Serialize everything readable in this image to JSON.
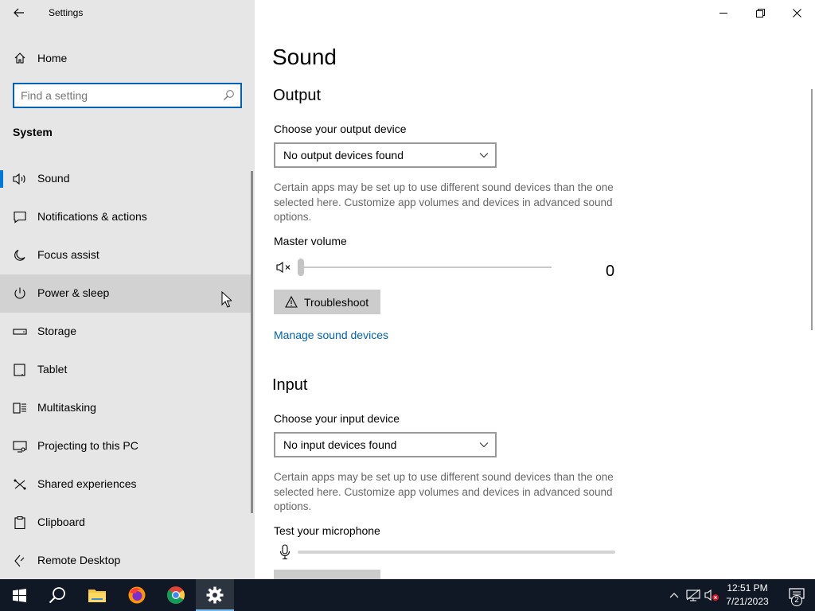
{
  "window": {
    "title": "Settings",
    "controls": [
      "minimize",
      "restore",
      "close"
    ]
  },
  "sidebar": {
    "home_label": "Home",
    "search_placeholder": "Find a setting",
    "section": "System",
    "items": [
      {
        "label": "Sound",
        "icon": "speaker-icon",
        "selected": true
      },
      {
        "label": "Notifications & actions",
        "icon": "message-icon"
      },
      {
        "label": "Focus assist",
        "icon": "moon-icon"
      },
      {
        "label": "Power & sleep",
        "icon": "power-icon",
        "hover": true
      },
      {
        "label": "Storage",
        "icon": "drive-icon"
      },
      {
        "label": "Tablet",
        "icon": "tablet-icon"
      },
      {
        "label": "Multitasking",
        "icon": "multitask-icon"
      },
      {
        "label": "Projecting to this PC",
        "icon": "projector-icon"
      },
      {
        "label": "Shared experiences",
        "icon": "shared-icon"
      },
      {
        "label": "Clipboard",
        "icon": "clipboard-icon"
      },
      {
        "label": "Remote Desktop",
        "icon": "remote-desktop-icon"
      }
    ]
  },
  "main": {
    "title": "Sound",
    "output": {
      "heading": "Output",
      "device_label": "Choose your output device",
      "device_value": "No output devices found",
      "description": "Certain apps may be set up to use different sound devices than the one selected here. Customize app volumes and devices in advanced sound options.",
      "volume_label": "Master volume",
      "volume_value": "0",
      "volume_level": 0,
      "troubleshoot_label": "Troubleshoot",
      "manage_link": "Manage sound devices"
    },
    "input": {
      "heading": "Input",
      "device_label": "Choose your input device",
      "device_value": "No input devices found",
      "description": "Certain apps may be set up to use different sound devices than the one selected here. Customize app volumes and devices in advanced sound options.",
      "test_label": "Test your microphone",
      "mic_level": 0
    }
  },
  "taskbar": {
    "apps": [
      "start",
      "search",
      "file-explorer",
      "firefox",
      "chrome",
      "settings"
    ],
    "active_app": "settings",
    "clock_time": "12:51 PM",
    "clock_date": "7/21/2023",
    "notification_count": "2"
  },
  "colors": {
    "accent": "#0078d7",
    "link": "#0063b1",
    "sidebar_bg": "#e6e6e6",
    "taskbar_bg": "#101825"
  }
}
